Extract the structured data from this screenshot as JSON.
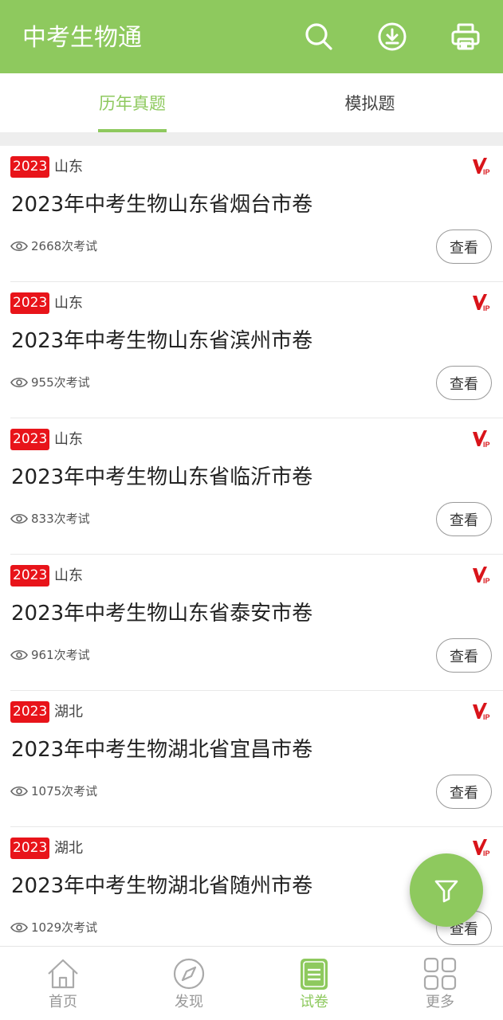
{
  "header": {
    "title": "中考生物通",
    "icons": [
      "search-icon",
      "download-icon",
      "printer-icon"
    ],
    "bg_color": "#8ec95e"
  },
  "tabs": [
    {
      "label": "历年真题",
      "active": true
    },
    {
      "label": "模拟题",
      "active": false
    }
  ],
  "papers": [
    {
      "year": "2023",
      "province": "山东",
      "title": "2023年中考生物山东省烟台市卷",
      "count": "2668次考试",
      "action": "查看",
      "vip": true
    },
    {
      "year": "2023",
      "province": "山东",
      "title": "2023年中考生物山东省滨州市卷",
      "count": "955次考试",
      "action": "查看",
      "vip": true
    },
    {
      "year": "2023",
      "province": "山东",
      "title": "2023年中考生物山东省临沂市卷",
      "count": "833次考试",
      "action": "查看",
      "vip": true
    },
    {
      "year": "2023",
      "province": "山东",
      "title": "2023年中考生物山东省泰安市卷",
      "count": "961次考试",
      "action": "查看",
      "vip": true
    },
    {
      "year": "2023",
      "province": "湖北",
      "title": "2023年中考生物湖北省宜昌市卷",
      "count": "1075次考试",
      "action": "查看",
      "vip": true
    },
    {
      "year": "2023",
      "province": "湖北",
      "title": "2023年中考生物湖北省随州市卷",
      "count": "1029次考试",
      "action": "查看",
      "vip": true
    }
  ],
  "fab": {
    "icon": "filter-icon"
  },
  "bottom_nav": [
    {
      "label": "首页",
      "icon": "home-icon",
      "active": false
    },
    {
      "label": "发现",
      "icon": "compass-icon",
      "active": false
    },
    {
      "label": "试卷",
      "icon": "document-icon",
      "active": true
    },
    {
      "label": "更多",
      "icon": "grid-icon",
      "active": false
    }
  ],
  "colors": {
    "accent": "#8ec95e",
    "badge": "#e8141a",
    "vip": "#d9141a"
  }
}
